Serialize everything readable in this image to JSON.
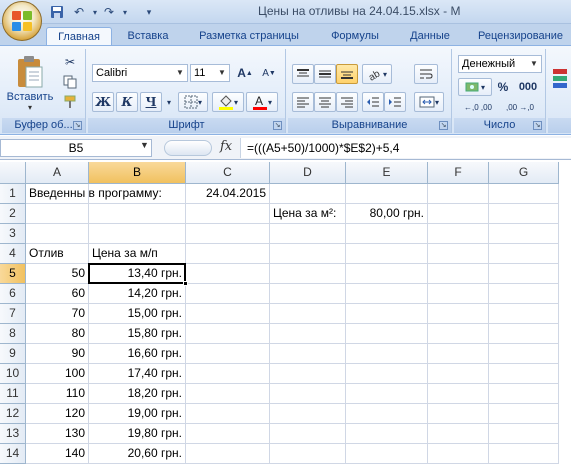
{
  "window": {
    "title": "Цены на отливы на 24.04.15.xlsx - M"
  },
  "quick_access": {
    "save_icon": "save-icon",
    "undo_icon": "undo-icon",
    "redo_icon": "redo-icon",
    "customize_icon": "customize-qat-icon"
  },
  "tabs": [
    {
      "label": "Главная",
      "active": true
    },
    {
      "label": "Вставка"
    },
    {
      "label": "Разметка страницы"
    },
    {
      "label": "Формулы"
    },
    {
      "label": "Данные"
    },
    {
      "label": "Рецензирование"
    }
  ],
  "ribbon": {
    "clipboard": {
      "label": "Буфер об...",
      "paste_label": "Вставить"
    },
    "font": {
      "label": "Шрифт",
      "font_name": "Calibri",
      "font_size": "11",
      "bold": "Ж",
      "italic": "К",
      "underline": "Ч"
    },
    "alignment": {
      "label": "Выравнивание"
    },
    "number": {
      "label": "Число",
      "format": "Денежный",
      "percent": "%",
      "thousands": "000",
      "inc_decimal": "←,0 ,00",
      "dec_decimal": ",00 →,0"
    },
    "colors": {
      "highlight": "#ffff00",
      "font_color": "#ff0000"
    }
  },
  "formula_bar": {
    "name_box": "B5",
    "fx": "fx",
    "formula": "=(((A5+50)/1000)*$E$2)+5,4"
  },
  "grid": {
    "columns": [
      "A",
      "B",
      "C",
      "D",
      "E",
      "F",
      "G"
    ],
    "selected_column": "B",
    "selected_row": "5",
    "rows": [
      {
        "n": "1",
        "cells": {
          "A": "Введенны в программу:",
          "C": "24.04.2015"
        }
      },
      {
        "n": "2",
        "cells": {
          "D": "Цена за м²:",
          "E": "80,00 грн."
        }
      },
      {
        "n": "3",
        "cells": {}
      },
      {
        "n": "4",
        "cells": {
          "A": "Отлив",
          "B": "Цена за м/п"
        }
      },
      {
        "n": "5",
        "cells": {
          "A": "50",
          "B": "13,40 грн."
        }
      },
      {
        "n": "6",
        "cells": {
          "A": "60",
          "B": "14,20 грн."
        }
      },
      {
        "n": "7",
        "cells": {
          "A": "70",
          "B": "15,00 грн."
        }
      },
      {
        "n": "8",
        "cells": {
          "A": "80",
          "B": "15,80 грн."
        }
      },
      {
        "n": "9",
        "cells": {
          "A": "90",
          "B": "16,60 грн."
        }
      },
      {
        "n": "10",
        "cells": {
          "A": "100",
          "B": "17,40 грн."
        }
      },
      {
        "n": "11",
        "cells": {
          "A": "110",
          "B": "18,20 грн."
        }
      },
      {
        "n": "12",
        "cells": {
          "A": "120",
          "B": "19,00 грн."
        }
      },
      {
        "n": "13",
        "cells": {
          "A": "130",
          "B": "19,80 грн."
        }
      },
      {
        "n": "14",
        "cells": {
          "A": "140",
          "B": "20,60 грн."
        }
      }
    ]
  }
}
